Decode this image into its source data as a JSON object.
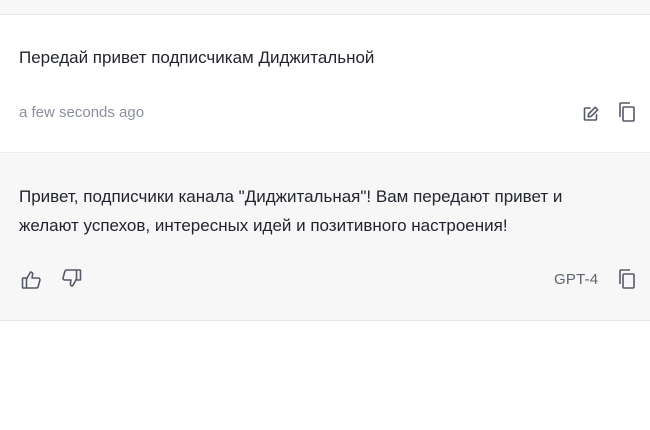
{
  "user_message": {
    "text": "Передай привет подписчикам Диджитальной",
    "timestamp": "a few seconds ago",
    "actions": [
      "edit-icon",
      "copy-icon"
    ]
  },
  "assistant_message": {
    "text": "Привет, подписчики канала \"Диджитальная\"! Вам передают привет и\nжелают успехов, интересных идей и позитивного настроения!",
    "model": "GPT-4",
    "actions": [
      "thumbs-up-icon",
      "thumbs-down-icon",
      "copy-icon"
    ]
  },
  "colors": {
    "background": "#ffffff",
    "assistant_background": "#f7f7f8",
    "text": "#22252e",
    "muted_text": "#8a8f9c",
    "icon": "#555a66"
  }
}
